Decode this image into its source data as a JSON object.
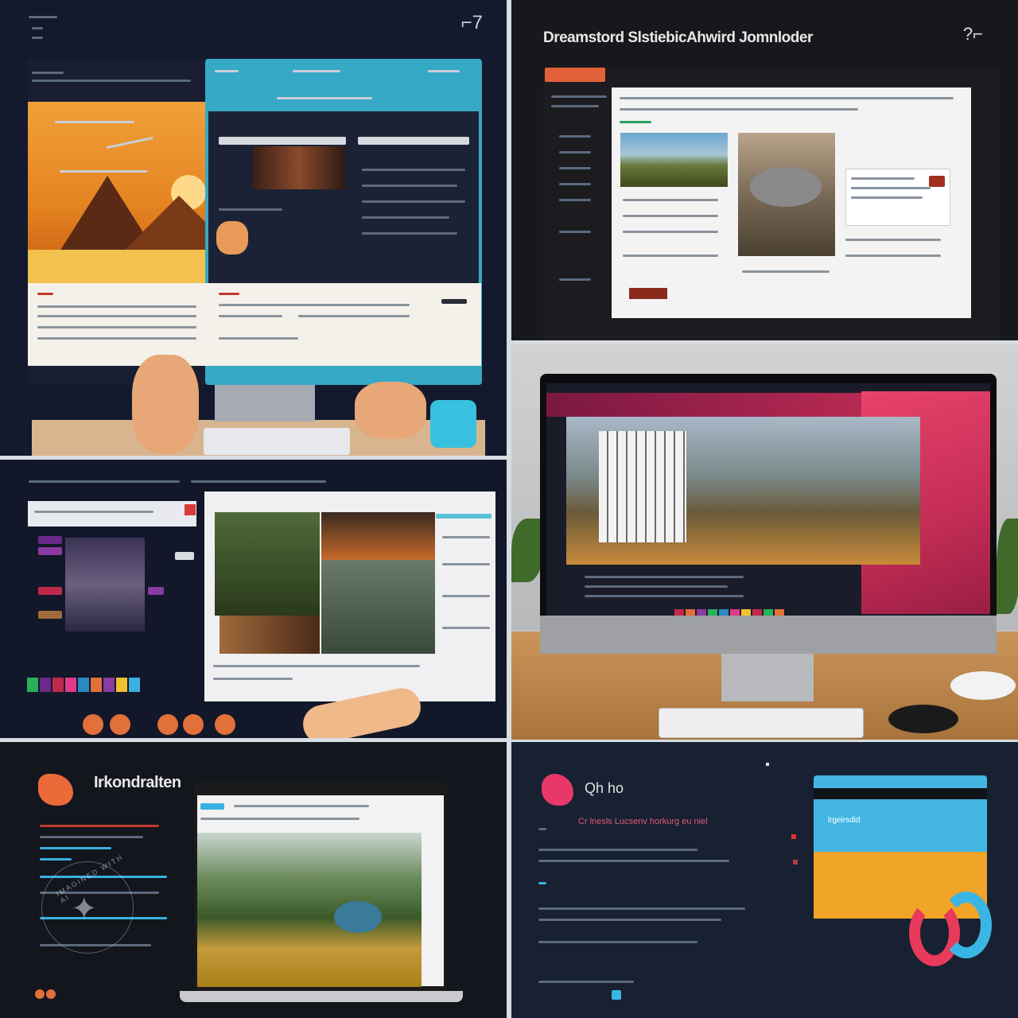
{
  "panel_top_right": {
    "title": "Dreamstord SlstiebicAhwird Jomnloder"
  },
  "panel_bottom_left": {
    "brand": "Irkondralten",
    "watermark": "IMAGINED WITH AI"
  },
  "panel_bottom_right": {
    "brand": "Qh ho",
    "subtitle": "Cr lnesls Lucsenv horkurg eu niel",
    "card_label": "lrgeirsdid"
  },
  "colors": {
    "accent_orange": "#e2603a",
    "accent_teal": "#35a9c6",
    "accent_pink": "#e8436a",
    "accent_blue": "#43b6e4",
    "background_dark": "#141a2e"
  }
}
